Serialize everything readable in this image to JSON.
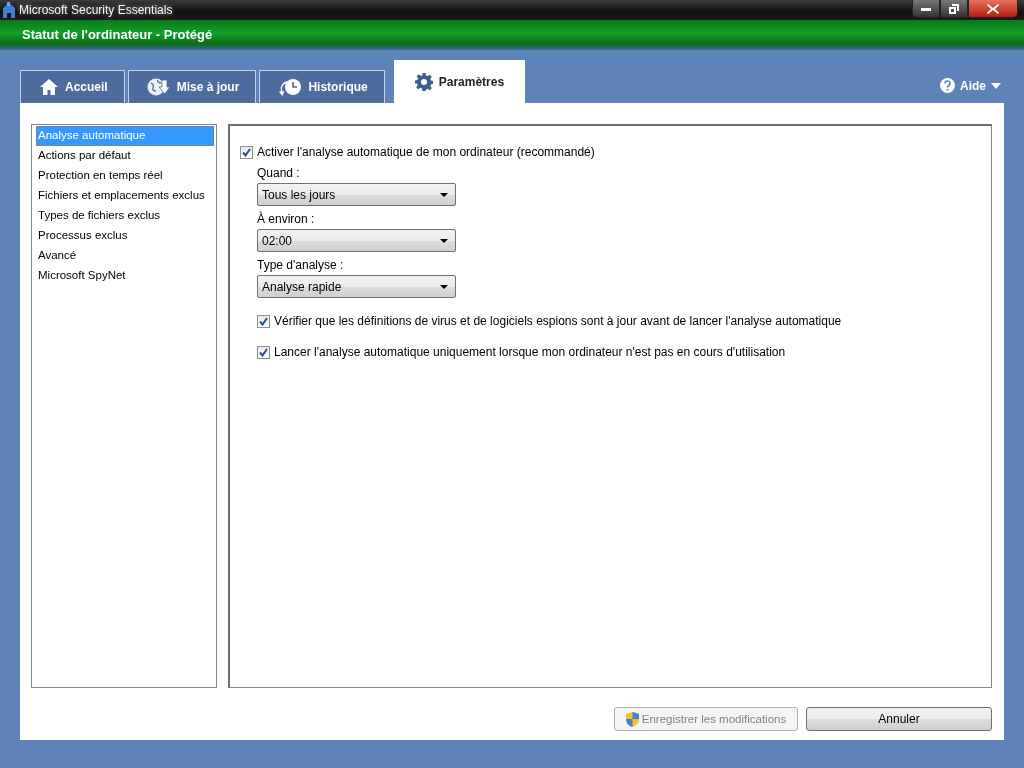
{
  "window": {
    "title": "Microsoft Security Essentials"
  },
  "status": {
    "text": "Statut de l'ordinateur - Protégé"
  },
  "tabs": [
    {
      "label": "Accueil",
      "kind": "home",
      "selected": false
    },
    {
      "label": "Mise à jour",
      "kind": "update",
      "selected": false
    },
    {
      "label": "Historique",
      "kind": "history",
      "selected": false
    },
    {
      "label": "Paramètres",
      "kind": "settings",
      "selected": true
    }
  ],
  "help": {
    "label": "Aide"
  },
  "sidebar": {
    "items": [
      {
        "label": "Analyse automatique",
        "selected": true
      },
      {
        "label": "Actions par défaut",
        "selected": false
      },
      {
        "label": "Protection en temps réel",
        "selected": false
      },
      {
        "label": "Fichiers et emplacements exclus",
        "selected": false
      },
      {
        "label": "Types de fichiers exclus",
        "selected": false
      },
      {
        "label": "Processus exclus",
        "selected": false
      },
      {
        "label": "Avancé",
        "selected": false
      },
      {
        "label": "Microsoft SpyNet",
        "selected": false
      }
    ]
  },
  "settings": {
    "enable": {
      "label": "Activer l'analyse automatique de mon ordinateur (recommandé)",
      "checked": true
    },
    "fields": [
      {
        "label": "Quand :",
        "value": "Tous les jours"
      },
      {
        "label": "À environ :",
        "value": "02:00"
      },
      {
        "label": "Type d'analyse :",
        "value": "Analyse rapide"
      }
    ],
    "options": [
      {
        "label": "Vérifier que les définitions de virus et de logiciels espions sont à jour avant de lancer l'analyse automatique",
        "checked": true
      },
      {
        "label": "Lancer l'analyse automatique uniquement lorsque mon ordinateur n'est pas en cours d'utilisation",
        "checked": true
      }
    ]
  },
  "buttons": [
    {
      "label": "Enregistrer les modifications",
      "kind": "shield",
      "disabled": true
    },
    {
      "label": "Annuler",
      "kind": "plain",
      "disabled": false
    }
  ]
}
